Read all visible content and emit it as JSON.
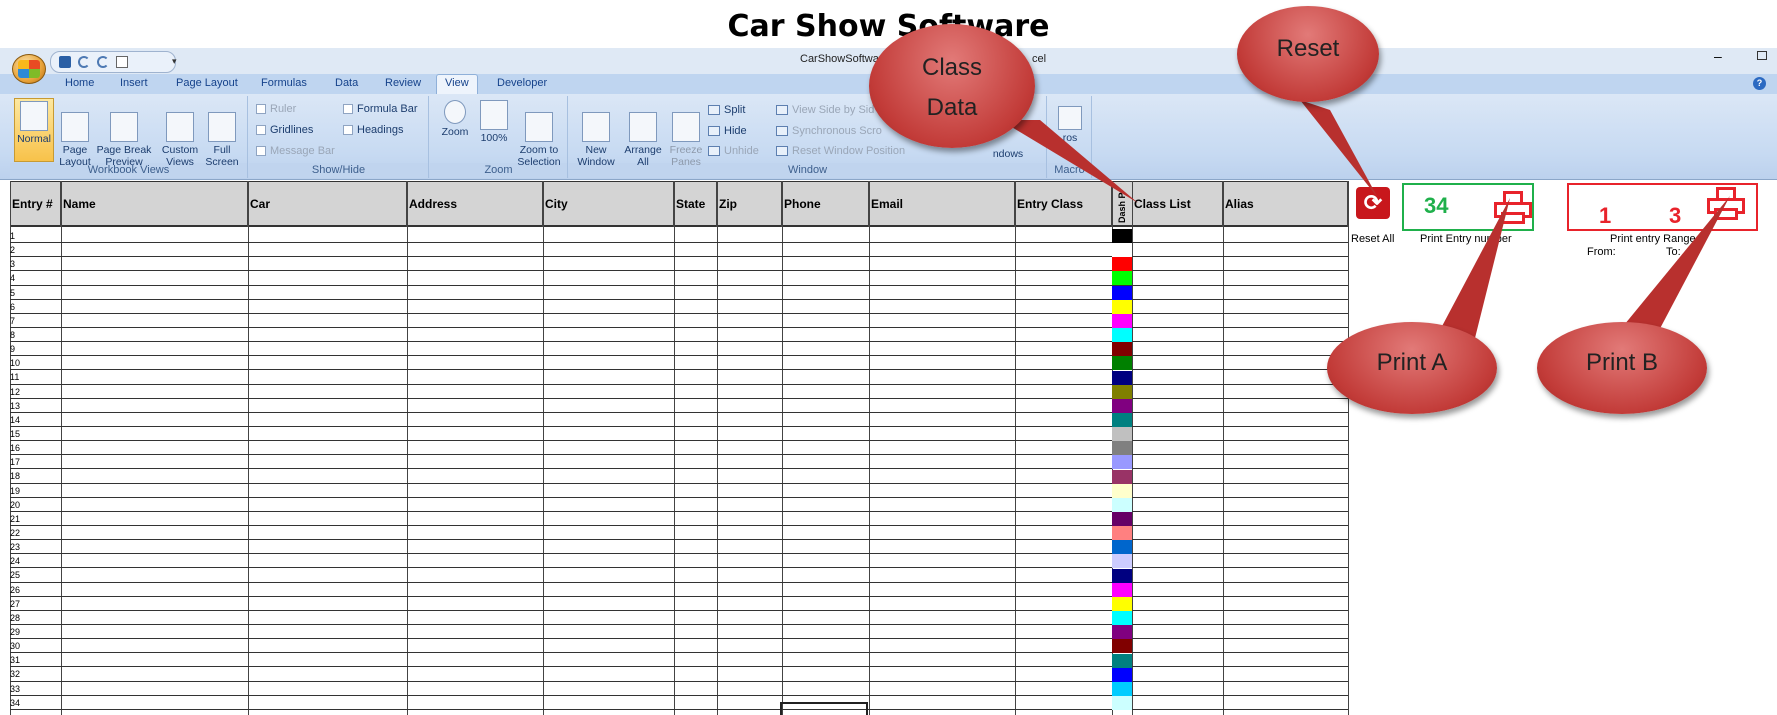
{
  "doc_title": "Car Show Software",
  "window": {
    "title_left": "CarShowSoftwa",
    "title_right": "cel"
  },
  "tabs": [
    "Home",
    "Insert",
    "Page Layout",
    "Formulas",
    "Data",
    "Review",
    "View",
    "Developer"
  ],
  "active_tab": "View",
  "ribbon": {
    "workbook_views": {
      "label": "Workbook Views",
      "buttons": [
        {
          "label": "Normal"
        },
        {
          "label": "Page\nLayout"
        },
        {
          "label": "Page Break\nPreview"
        },
        {
          "label": "Custom\nViews"
        },
        {
          "label": "Full\nScreen"
        }
      ]
    },
    "show_hide": {
      "label": "Show/Hide",
      "ruler": "Ruler",
      "gridlines": "Gridlines",
      "message_bar": "Message Bar",
      "formula_bar": "Formula Bar",
      "headings": "Headings"
    },
    "zoom": {
      "label": "Zoom",
      "zoom": "Zoom",
      "hundred": "100%",
      "selection": "Zoom to\nSelection"
    },
    "window": {
      "label": "Window",
      "new_window": "New\nWindow",
      "arrange_all": "Arrange\nAll",
      "freeze_panes": "Freeze\nPanes",
      "split": "Split",
      "hide": "Hide",
      "unhide": "Unhide",
      "side_by_side": "View Side by Sid",
      "sync_scroll": "Synchronous Scro",
      "reset_pos": "Reset Window Position",
      "switch_windows": "ndows"
    },
    "macros": {
      "label": "Macro",
      "button": "ros"
    }
  },
  "sheet": {
    "headers": [
      "Entry #",
      "Name",
      "Car",
      "Address",
      "City",
      "State",
      "Zip",
      "Phone",
      "Email",
      "Entry Class",
      "Dash P",
      "Class List",
      "Alias"
    ],
    "row_numbers": [
      "1",
      "2",
      "3",
      "4",
      "5",
      "6",
      "7",
      "8",
      "9",
      "10",
      "11",
      "12",
      "13",
      "14",
      "15",
      "16",
      "17",
      "18",
      "19",
      "20",
      "21",
      "22",
      "23",
      "24",
      "25",
      "26",
      "27",
      "28",
      "29",
      "30",
      "31",
      "32",
      "33",
      "34"
    ],
    "dash_colors": [
      "#000000",
      "#ffffff",
      "#ff0000",
      "#00ff00",
      "#0000ff",
      "#ffff00",
      "#ff00ff",
      "#00ffff",
      "#800000",
      "#008000",
      "#000080",
      "#808000",
      "#800080",
      "#008080",
      "#c0c0c0",
      "#808080",
      "#9999ff",
      "#993366",
      "#ffffcc",
      "#ccffff",
      "#660066",
      "#ff8080",
      "#0066cc",
      "#ccccff",
      "#000080",
      "#ff00ff",
      "#ffff00",
      "#00ffff",
      "#800080",
      "#800000",
      "#008080",
      "#0000ff",
      "#00ccff",
      "#ccffff"
    ]
  },
  "panel": {
    "reset_label": "Reset All",
    "print_entry_value": "34",
    "print_entry_label": "Print Entry number",
    "range_from_value": "1",
    "range_to_value": "3",
    "range_label": "Print entry Range",
    "from_label": "From:",
    "to_label": "To:"
  },
  "callouts": {
    "class_data": "Class\nData",
    "reset": "Reset",
    "print_a": "Print A",
    "print_b": "Print B"
  }
}
